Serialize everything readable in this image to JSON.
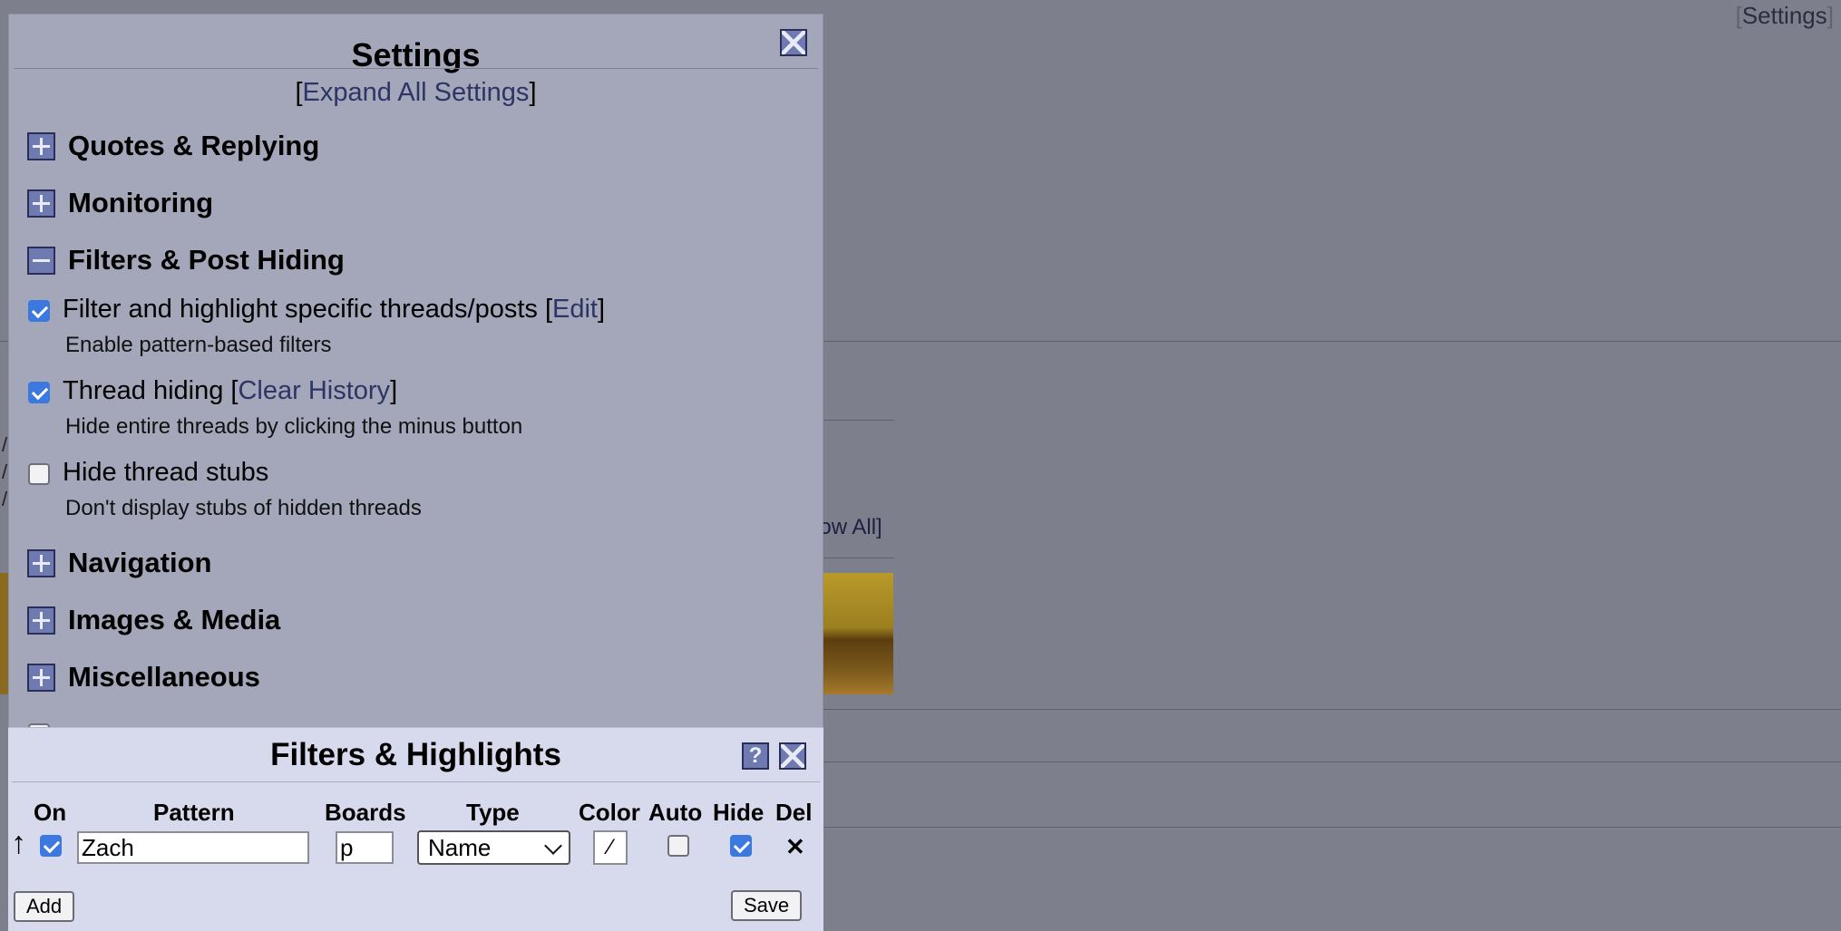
{
  "background": {
    "settings_link_open": "[",
    "settings_link": "Settings",
    "settings_link_close": "]",
    "show_all": "how All]",
    "slashes": [
      "/",
      "/",
      "/"
    ]
  },
  "settings": {
    "title": "Settings",
    "expand_open": "[",
    "expand_all": "Expand All Settings",
    "expand_close": "]",
    "sections": [
      {
        "label": "Quotes & Replying",
        "expanded": false
      },
      {
        "label": "Monitoring",
        "expanded": false
      },
      {
        "label": "Filters & Post Hiding",
        "expanded": true
      },
      {
        "label": "Navigation",
        "expanded": false
      },
      {
        "label": "Images & Media",
        "expanded": false
      },
      {
        "label": "Miscellaneous",
        "expanded": false
      }
    ],
    "options": [
      {
        "label": "Filter and highlight specific threads/posts [",
        "link": "Edit",
        "suffix": "]",
        "desc": "Enable pattern-based filters",
        "checked": true
      },
      {
        "label": "Thread hiding [",
        "link": "Clear History",
        "suffix": "]",
        "desc": "Hide entire threads by clicking the minus button",
        "checked": true
      },
      {
        "label": "Hide thread stubs",
        "link": "",
        "suffix": "",
        "desc": "Don't display stubs of hidden threads",
        "checked": false
      }
    ]
  },
  "filters": {
    "title": "Filters & Highlights",
    "help": "?",
    "columns": {
      "on": "On",
      "pattern": "Pattern",
      "boards": "Boards",
      "type": "Type",
      "color": "Color",
      "auto": "Auto",
      "hide": "Hide",
      "del": "Del"
    },
    "row": {
      "arrow": "↑",
      "on": true,
      "pattern": "Zach",
      "boards": "p",
      "type": "Name",
      "color_glyph": "⁄",
      "auto": false,
      "hide": true,
      "del": "✕"
    },
    "add_label": "Add",
    "save_label": "Save"
  }
}
